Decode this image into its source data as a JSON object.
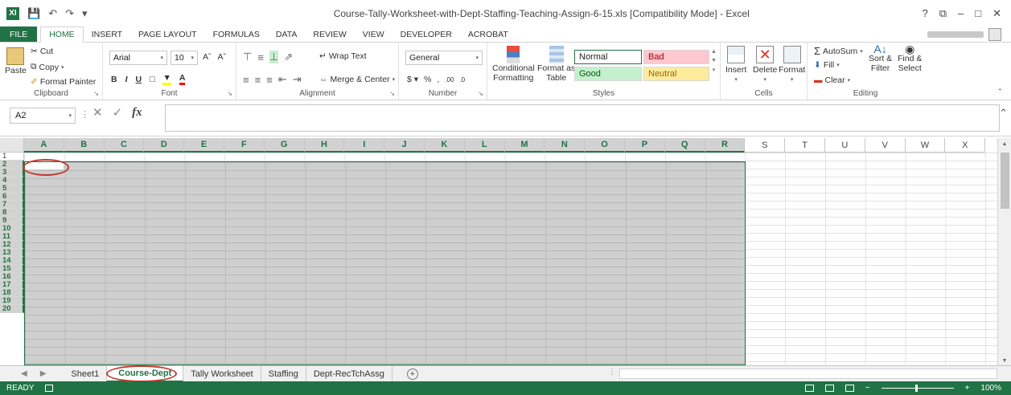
{
  "window": {
    "title": "Course-Tally-Worksheet-with-Dept-Staffing-Teaching-Assign-6-15.xls  [Compatibility Mode] - Excel",
    "app_logo": "XI",
    "controls": [
      "?",
      "⧉",
      "–",
      "□",
      "✕"
    ]
  },
  "tabs": {
    "file": "FILE",
    "items": [
      "HOME",
      "INSERT",
      "PAGE LAYOUT",
      "FORMULAS",
      "DATA",
      "REVIEW",
      "VIEW",
      "DEVELOPER",
      "ACROBAT"
    ],
    "active": "HOME"
  },
  "ribbon": {
    "clipboard": {
      "label": "Clipboard",
      "paste": "Paste",
      "cut": "Cut",
      "copy": "Copy",
      "format_painter": "Format Painter"
    },
    "font": {
      "label": "Font",
      "name": "Arial",
      "size": "10"
    },
    "alignment": {
      "label": "Alignment",
      "wrap_text": "Wrap Text",
      "merge_center": "Merge & Center"
    },
    "number": {
      "label": "Number",
      "format": "General"
    },
    "styles": {
      "label": "Styles",
      "conditional": "Conditional",
      "formatting": "Formatting",
      "format_as": "Format as",
      "table": "Table",
      "normal": "Normal",
      "bad": "Bad",
      "good": "Good",
      "neutral": "Neutral"
    },
    "cells": {
      "label": "Cells",
      "insert": "Insert",
      "delete": "Delete",
      "format": "Format"
    },
    "editing": {
      "label": "Editing",
      "autosum": "AutoSum",
      "fill": "Fill",
      "clear": "Clear",
      "sort": "Sort &",
      "filter": "Filter",
      "find": "Find &",
      "select": "Select"
    }
  },
  "formula_bar": {
    "name_box": "A2",
    "fx": "fx",
    "value": ""
  },
  "grid": {
    "columns": [
      "A",
      "B",
      "C",
      "D",
      "E",
      "F",
      "G",
      "H",
      "I",
      "J",
      "K",
      "L",
      "M",
      "N",
      "O",
      "P",
      "Q",
      "R",
      "S",
      "T",
      "U",
      "V",
      "W",
      "X"
    ],
    "rows": [
      "1",
      "2",
      "3",
      "4",
      "5",
      "6",
      "7",
      "8",
      "9",
      "10",
      "11",
      "12",
      "13",
      "14",
      "15",
      "16",
      "17",
      "18",
      "19",
      "20"
    ],
    "selected_range": "A2:R20",
    "active_cell": "A2"
  },
  "sheets": {
    "tabs": [
      "Sheet1",
      "Course-Dept",
      "Tally Worksheet",
      "Staffing",
      "Dept-RecTchAssg"
    ],
    "active": "Course-Dept"
  },
  "status": {
    "ready": "READY",
    "zoom": "100%"
  },
  "colors": {
    "accent": "#217346",
    "selection": "#cfcfcf",
    "annotation": "#c0392b",
    "bad_bg": "#ffc7ce",
    "good_bg": "#c6efce",
    "neutral_bg": "#ffeb9c"
  }
}
